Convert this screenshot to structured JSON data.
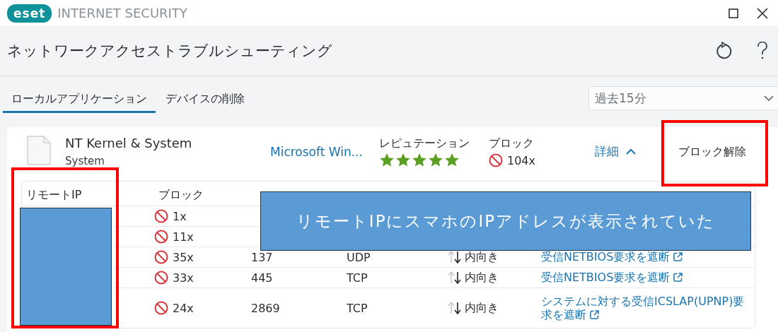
{
  "window": {
    "logo": "eset",
    "title": "INTERNET SECURITY"
  },
  "page": {
    "title": "ネットワークアクセストラブルシューティング"
  },
  "tabs": [
    {
      "label": "ローカルアプリケーション",
      "selected": true
    },
    {
      "label": "デバイスの削除",
      "selected": false
    }
  ],
  "time_filter": {
    "value": "過去15分"
  },
  "application": {
    "name": "NT Kernel & System",
    "path": "System",
    "publisher": "Microsoft Win...",
    "reputation_label": "レピュテーション",
    "stars": 5,
    "blocked_label": "ブロック",
    "blocked_count": "104x",
    "details_link": "詳細",
    "expanded": true,
    "unblock_button": "ブロック解除"
  },
  "table": {
    "columns": [
      "リモートIP",
      "ブロック"
    ],
    "rows": [
      {
        "blocked": "1x"
      },
      {
        "blocked": "11x"
      },
      {
        "blocked": "35x",
        "port": "137",
        "protocol": "UDP",
        "direction": "内向き",
        "rule": "受信NETBIOS要求を遮断"
      },
      {
        "blocked": "33x",
        "port": "445",
        "protocol": "TCP",
        "direction": "内向き",
        "rule": "受信NETBIOS要求を遮断"
      },
      {
        "blocked": "24x",
        "port": "2869",
        "protocol": "TCP",
        "direction": "内向き",
        "rule": "システムに対する受信ICSLAP(UPNP)要求を遮断"
      }
    ]
  },
  "annotation": {
    "callout": "リモートIPにスマホのIPアドレスが表示されていた"
  }
}
